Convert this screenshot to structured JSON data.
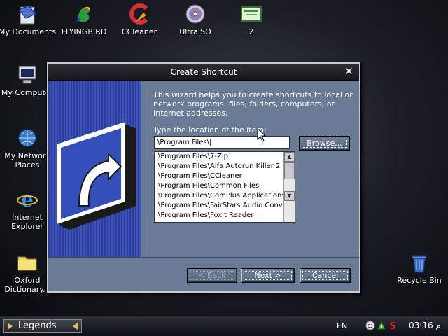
{
  "desktop": {
    "icons": [
      {
        "label": "My Documents",
        "icon": "my-documents-icon"
      },
      {
        "label": "FLYINGBIRD",
        "icon": "bird-icon"
      },
      {
        "label": "CCleaner",
        "icon": "ccleaner-icon"
      },
      {
        "label": "UltraISO",
        "icon": "disc-icon"
      },
      {
        "label": "2",
        "icon": "certificate-icon"
      },
      {
        "label": "My Computer",
        "icon": "monitor-icon"
      },
      {
        "label": "My Network Places",
        "icon": "network-globe-icon"
      },
      {
        "label": "Internet Explorer",
        "icon": "ie-icon"
      },
      {
        "label": "Oxford Dictionary...",
        "icon": "folder-icon"
      },
      {
        "label": "Recycle Bin",
        "icon": "recycle-bin-icon"
      }
    ]
  },
  "dialog": {
    "title": "Create Shortcut",
    "description": "This wizard helps you to create shortcuts to local or network programs, files, folders, computers, or Internet addresses.",
    "location_label": "Type the location of the item:",
    "location_value": "\\Program Files\\|",
    "browse_label": "Browse...",
    "back_label": "< Back",
    "next_label": "Next >",
    "cancel_label": "Cancel",
    "suggestions": [
      "\\Program Files\\7-Zip",
      "\\Program Files\\Alfa Autorun Killer 2",
      "\\Program Files\\CCleaner",
      "\\Program Files\\Common Files",
      "\\Program Files\\ComPlus Applications",
      "\\Program Files\\FairStars Audio Conve",
      "\\Program Files\\Foxit Reader"
    ]
  },
  "taskbar": {
    "start_label": "Legends",
    "language": "EN",
    "clock": "03:16 م",
    "tray_icons": [
      "smiley-icon",
      "network-status-icon",
      "antivirus-s-icon"
    ]
  }
}
